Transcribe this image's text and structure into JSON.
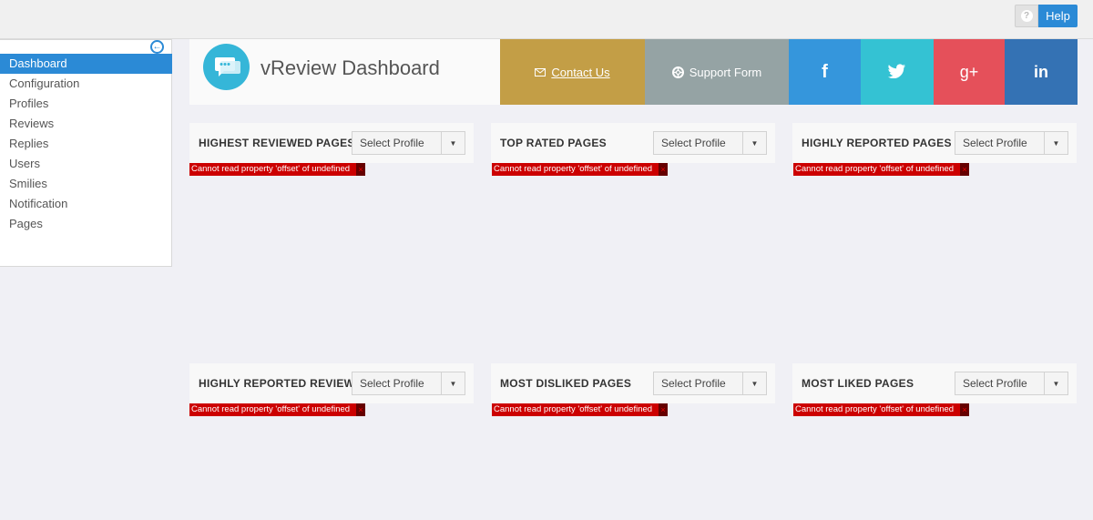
{
  "topbar": {
    "help_label": "Help",
    "help_icon": "question-icon"
  },
  "sidebar": {
    "collapse_icon": "arrow-left-circle-icon",
    "items": [
      {
        "label": "Dashboard",
        "active": true
      },
      {
        "label": "Configuration"
      },
      {
        "label": "Profiles"
      },
      {
        "label": "Reviews"
      },
      {
        "label": "Replies"
      },
      {
        "label": "Users"
      },
      {
        "label": "Smilies"
      },
      {
        "label": "Notification"
      },
      {
        "label": "Pages"
      }
    ]
  },
  "banner": {
    "title": "vReview Dashboard",
    "contact_label": " Contact Us",
    "support_label": "Support Form",
    "facebook_glyph": "f",
    "googleplus_glyph": "g+",
    "linkedin_glyph": "in",
    "colors": {
      "contact": "#c39e46",
      "support": "#95a3a4",
      "facebook": "#3596dc",
      "twitter": "#34c2d3",
      "googleplus": "#e5505a",
      "linkedin": "#3472b4"
    }
  },
  "widgets": [
    {
      "title": "HIGHEST REVIEWED PAGES",
      "select": "Select Profile",
      "error": "Cannot read property 'offset' of undefined"
    },
    {
      "title": "TOP RATED PAGES",
      "select": "Select Profile",
      "error": "Cannot read property 'offset' of undefined"
    },
    {
      "title": "HIGHLY REPORTED PAGES",
      "select": "Select Profile",
      "error": "Cannot read property 'offset' of undefined"
    },
    {
      "title": "HIGHLY REPORTED REVIEWS",
      "select": "Select Profile",
      "error": "Cannot read property 'offset' of undefined"
    },
    {
      "title": "MOST DISLIKED PAGES",
      "select": "Select Profile",
      "error": "Cannot read property 'offset' of undefined"
    },
    {
      "title": "MOST LIKED PAGES",
      "select": "Select Profile",
      "error": "Cannot read property 'offset' of undefined"
    }
  ],
  "error_close_glyph": "×",
  "accent_color": "#2b8ad6",
  "error_color": "#cc0000"
}
